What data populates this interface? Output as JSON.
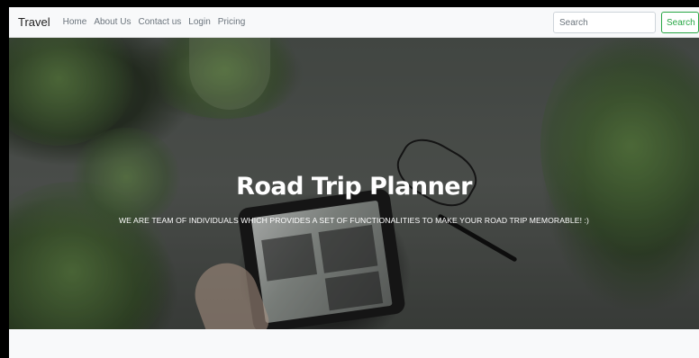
{
  "navbar": {
    "brand": "Travel",
    "links": [
      "Home",
      "About Us",
      "Contact us",
      "Login",
      "Pricing"
    ],
    "search": {
      "placeholder": "Search",
      "button_label": "Search"
    }
  },
  "hero": {
    "title": "Road Trip Planner",
    "subtitle": "WE ARE TEAM OF INDIVIDUALS WHICH PROVIDES A SET OF FUNCTIONALITIES TO MAKE YOUR ROAD TRIP MEMORABLE! :)"
  },
  "colors": {
    "navbar_bg": "#f8f9fa",
    "search_button": "#28a745",
    "hero_text": "#ffffff"
  }
}
